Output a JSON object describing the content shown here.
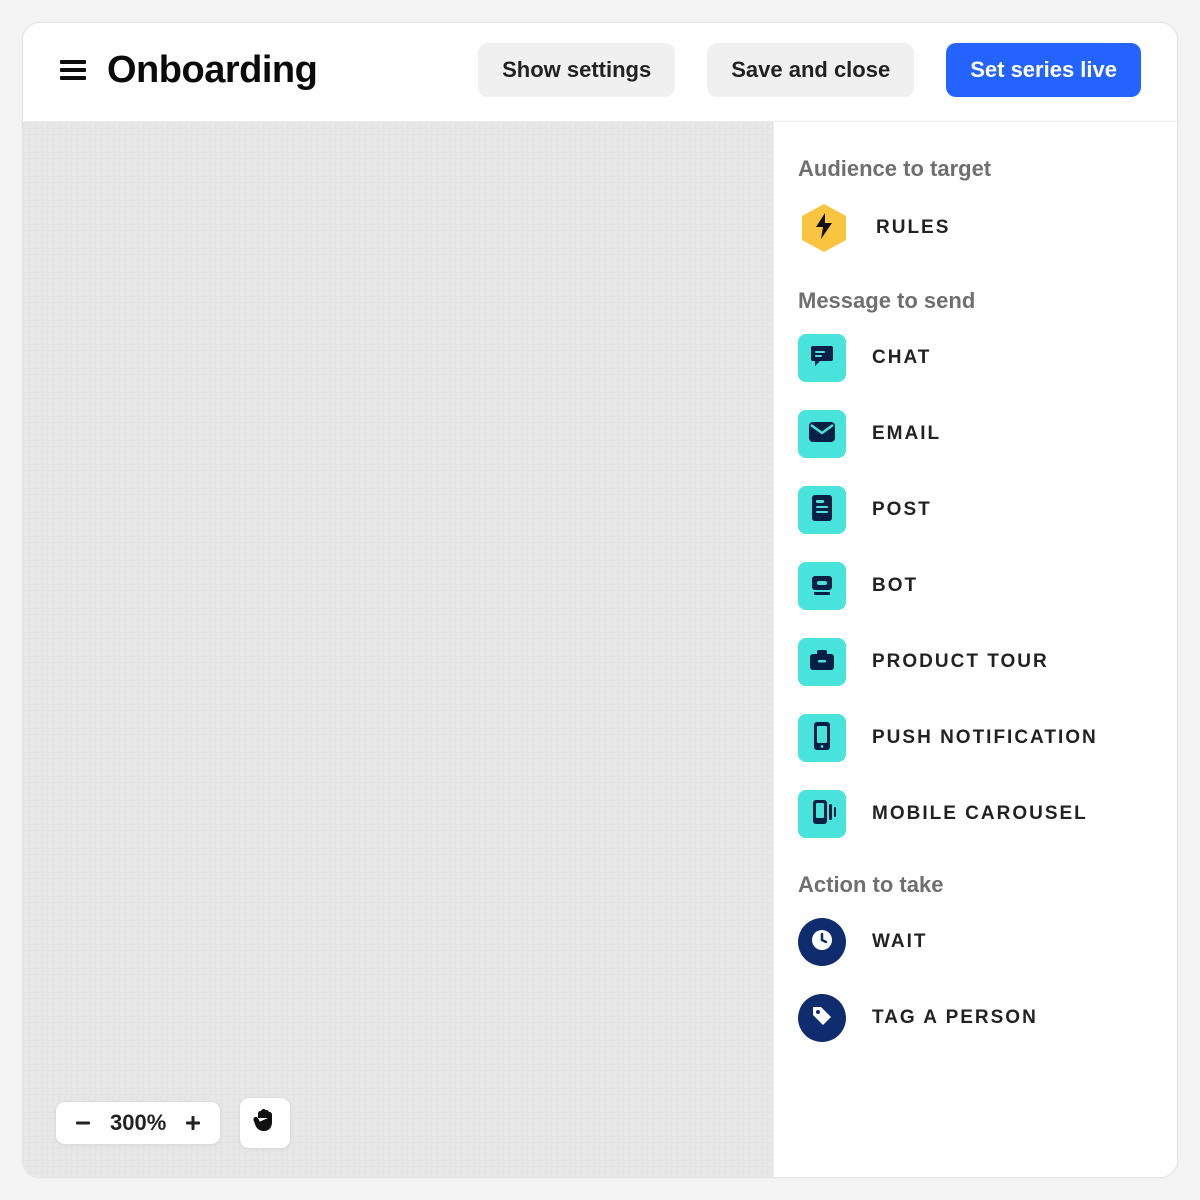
{
  "header": {
    "title": "Onboarding",
    "show_settings": "Show settings",
    "save_close": "Save and close",
    "set_live": "Set series live"
  },
  "zoom": {
    "level": "300%"
  },
  "sidebar": {
    "sections": {
      "audience": {
        "title": "Audience to target",
        "items": {
          "rules": "RULES"
        }
      },
      "message": {
        "title": "Message to send",
        "items": {
          "chat": "CHAT",
          "email": "EMAIL",
          "post": "POST",
          "bot": "BOT",
          "product_tour": "PRODUCT TOUR",
          "push": "PUSH NOTIFICATION",
          "carousel": "MOBILE CAROUSEL"
        }
      },
      "action": {
        "title": "Action to take",
        "items": {
          "wait": "WAIT",
          "tag": "TAG A PERSON"
        }
      }
    }
  },
  "colors": {
    "primary": "#2563ff",
    "tile_cyan": "#48e3db",
    "tile_navy": "#0f2c6e",
    "hex_yellow": "#f9c440"
  }
}
